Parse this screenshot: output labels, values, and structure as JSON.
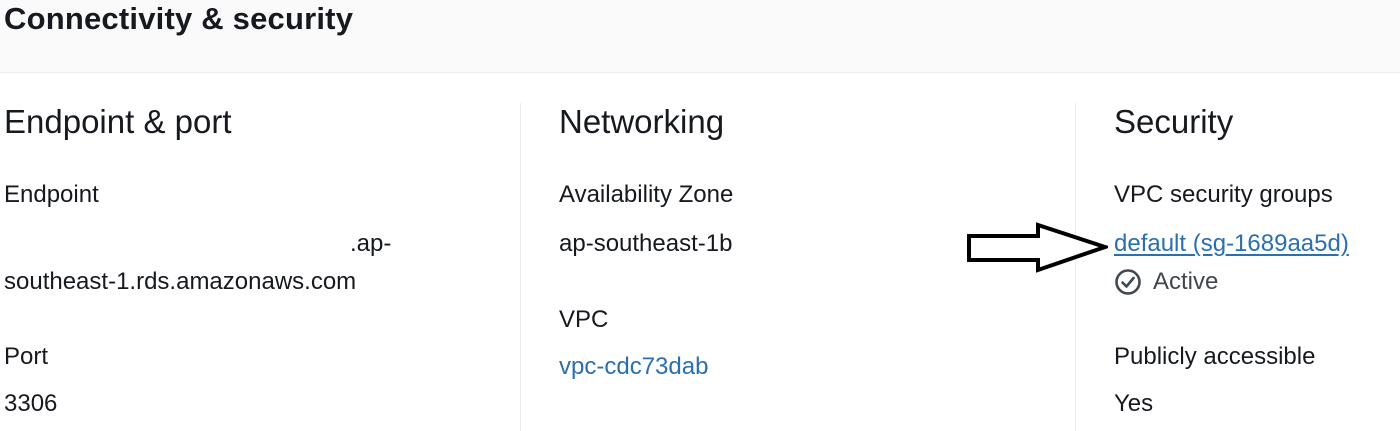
{
  "header": {
    "title": "Connectivity & security"
  },
  "endpoint_port": {
    "title": "Endpoint & port",
    "endpoint_label": "Endpoint",
    "endpoint_line1": ".ap-",
    "endpoint_line2": "southeast-1.rds.amazonaws.com",
    "port_label": "Port",
    "port_value": "3306"
  },
  "networking": {
    "title": "Networking",
    "az_label": "Availability Zone",
    "az_value": "ap-southeast-1b",
    "vpc_label": "VPC",
    "vpc_link": "vpc-cdc73dab"
  },
  "security": {
    "title": "Security",
    "sg_label": "VPC security groups",
    "sg_link": "default (sg-1689aa5d)",
    "sg_status": "Active",
    "public_label": "Publicly accessible",
    "public_value": "Yes"
  },
  "icons": {
    "status": "check-circle-icon",
    "annotation": "arrow-right-icon"
  },
  "colors": {
    "link": "#2a6fb0",
    "text": "#16191f",
    "status_icon": "#414750"
  }
}
